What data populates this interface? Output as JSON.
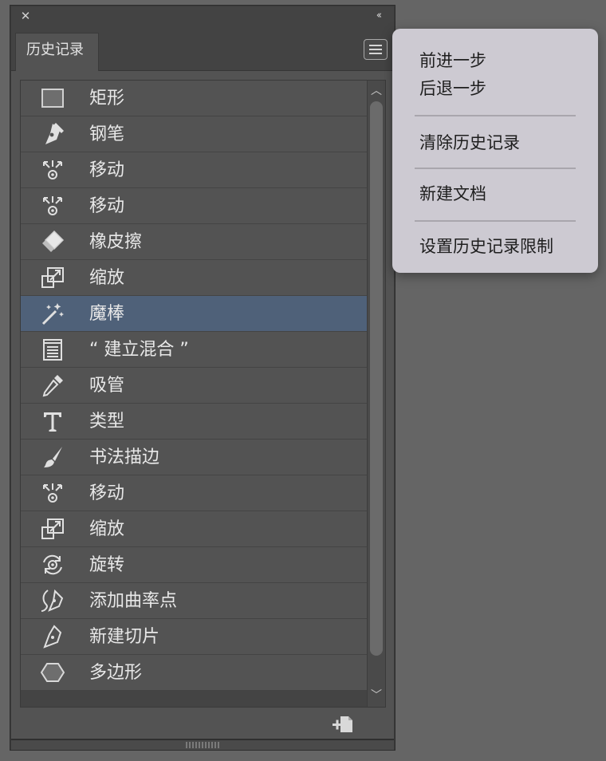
{
  "panel": {
    "tab_label": "历史记录",
    "close_glyph": "✕",
    "collapse_glyph": "‹‹"
  },
  "history": {
    "items": [
      {
        "label": "矩形",
        "icon": "rectangle-icon",
        "selected": false
      },
      {
        "label": "钢笔",
        "icon": "pen-tool-icon",
        "selected": false
      },
      {
        "label": "移动",
        "icon": "move-icon",
        "selected": false
      },
      {
        "label": "移动",
        "icon": "move-icon",
        "selected": false
      },
      {
        "label": "橡皮擦",
        "icon": "eraser-icon",
        "selected": false
      },
      {
        "label": "缩放",
        "icon": "scale-icon",
        "selected": false
      },
      {
        "label": "魔棒",
        "icon": "magic-wand-icon",
        "selected": true
      },
      {
        "label": "“ 建立混合 ”",
        "icon": "document-icon",
        "selected": false
      },
      {
        "label": "吸管",
        "icon": "eyedropper-icon",
        "selected": false
      },
      {
        "label": "类型",
        "icon": "type-tool-icon",
        "selected": false
      },
      {
        "label": "书法描边",
        "icon": "brush-icon",
        "selected": false
      },
      {
        "label": "移动",
        "icon": "move-icon",
        "selected": false
      },
      {
        "label": "缩放",
        "icon": "scale-icon",
        "selected": false
      },
      {
        "label": "旋转",
        "icon": "rotate-icon",
        "selected": false
      },
      {
        "label": "添加曲率点",
        "icon": "curvature-icon",
        "selected": false
      },
      {
        "label": "新建切片",
        "icon": "slice-pen-icon",
        "selected": false
      },
      {
        "label": "多边形",
        "icon": "polygon-icon",
        "selected": false
      }
    ]
  },
  "dropdown": {
    "items": [
      {
        "label": "前进一步"
      },
      {
        "label": "后退一步"
      },
      {
        "label": "清除历史记录"
      },
      {
        "label": "新建文档"
      },
      {
        "label": "设置历史记录限制"
      }
    ]
  },
  "colors": {
    "panel_bg": "#535353",
    "selected_row": "#4f6179",
    "menu_bg": "#cdcad2",
    "page_bg": "#656565"
  }
}
